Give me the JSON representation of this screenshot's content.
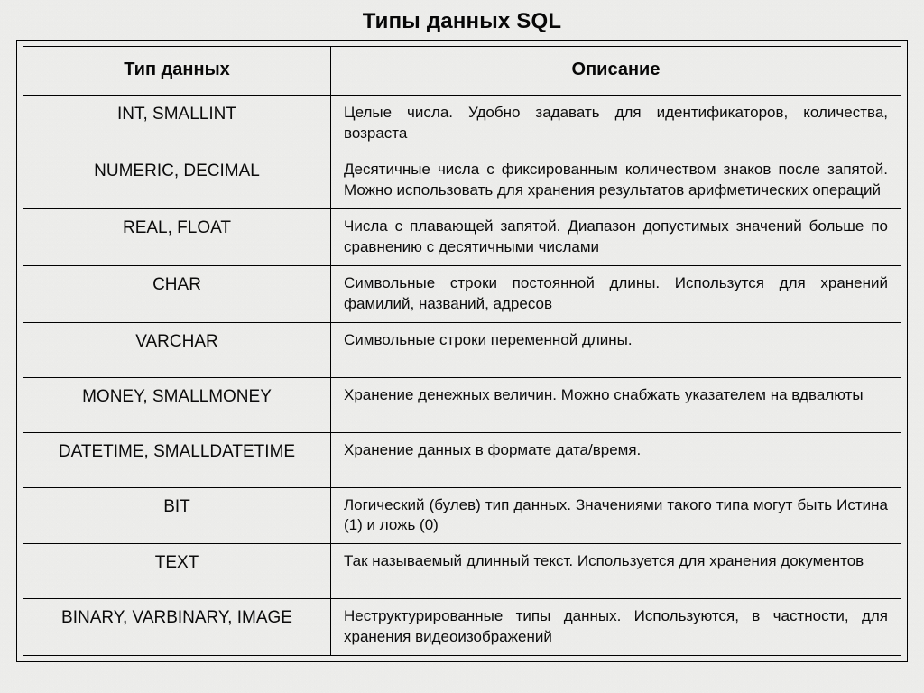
{
  "title": "Типы данных SQL",
  "table": {
    "headers": {
      "type": "Тип данных",
      "desc": "Описание"
    },
    "rows": [
      {
        "type": "INT, SMALLINT",
        "desc": "Целые числа. Удобно задавать для идентификаторов, количества, возраста"
      },
      {
        "type": "NUMERIC, DECIMAL",
        "desc": "Десятичные числа с фиксированным количеством знаков после запятой. Можно использовать для хранения результатов арифметических операций"
      },
      {
        "type": "REAL, FLOAT",
        "desc": "Числа с плавающей запятой. Диапазон допустимых значений больше по сравнению с десятичными числами"
      },
      {
        "type": "CHAR",
        "desc": "Символьные строки постоянной длины. Использутся для хранений фамилий, названий, адресов"
      },
      {
        "type": "VARCHAR",
        "desc": "Символьные строки переменной длины."
      },
      {
        "type": "MONEY, SMALLMONEY",
        "desc": "Хранение денежных величин. Можно снабжать указателем на вдвалюты"
      },
      {
        "type": "DATETIME, SMALLDATETIME",
        "desc": "Хранение данных в формате дата/время."
      },
      {
        "type": "BIT",
        "desc": "Логический (булев) тип данных. Значениями такого типа могут быть Истина (1) и ложь (0)"
      },
      {
        "type": "TEXT",
        "desc": "Так называемый длинный текст. Используется для хранения документов"
      },
      {
        "type": "BINARY, VARBINARY, IMAGE",
        "desc": "Неструктурированные типы данных. Используются, в частности, для хранения видеоизображений"
      }
    ]
  }
}
